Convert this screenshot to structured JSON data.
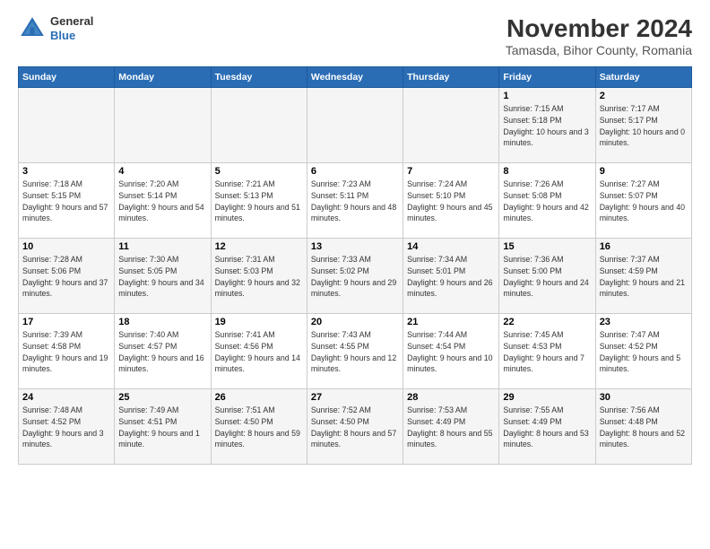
{
  "header": {
    "logo_line1": "General",
    "logo_line2": "Blue",
    "title": "November 2024",
    "subtitle": "Tamasda, Bihor County, Romania"
  },
  "weekdays": [
    "Sunday",
    "Monday",
    "Tuesday",
    "Wednesday",
    "Thursday",
    "Friday",
    "Saturday"
  ],
  "weeks": [
    [
      {
        "day": "",
        "sunrise": "",
        "sunset": "",
        "daylight": ""
      },
      {
        "day": "",
        "sunrise": "",
        "sunset": "",
        "daylight": ""
      },
      {
        "day": "",
        "sunrise": "",
        "sunset": "",
        "daylight": ""
      },
      {
        "day": "",
        "sunrise": "",
        "sunset": "",
        "daylight": ""
      },
      {
        "day": "",
        "sunrise": "",
        "sunset": "",
        "daylight": ""
      },
      {
        "day": "1",
        "sunrise": "Sunrise: 7:15 AM",
        "sunset": "Sunset: 5:18 PM",
        "daylight": "Daylight: 10 hours and 3 minutes."
      },
      {
        "day": "2",
        "sunrise": "Sunrise: 7:17 AM",
        "sunset": "Sunset: 5:17 PM",
        "daylight": "Daylight: 10 hours and 0 minutes."
      }
    ],
    [
      {
        "day": "3",
        "sunrise": "Sunrise: 7:18 AM",
        "sunset": "Sunset: 5:15 PM",
        "daylight": "Daylight: 9 hours and 57 minutes."
      },
      {
        "day": "4",
        "sunrise": "Sunrise: 7:20 AM",
        "sunset": "Sunset: 5:14 PM",
        "daylight": "Daylight: 9 hours and 54 minutes."
      },
      {
        "day": "5",
        "sunrise": "Sunrise: 7:21 AM",
        "sunset": "Sunset: 5:13 PM",
        "daylight": "Daylight: 9 hours and 51 minutes."
      },
      {
        "day": "6",
        "sunrise": "Sunrise: 7:23 AM",
        "sunset": "Sunset: 5:11 PM",
        "daylight": "Daylight: 9 hours and 48 minutes."
      },
      {
        "day": "7",
        "sunrise": "Sunrise: 7:24 AM",
        "sunset": "Sunset: 5:10 PM",
        "daylight": "Daylight: 9 hours and 45 minutes."
      },
      {
        "day": "8",
        "sunrise": "Sunrise: 7:26 AM",
        "sunset": "Sunset: 5:08 PM",
        "daylight": "Daylight: 9 hours and 42 minutes."
      },
      {
        "day": "9",
        "sunrise": "Sunrise: 7:27 AM",
        "sunset": "Sunset: 5:07 PM",
        "daylight": "Daylight: 9 hours and 40 minutes."
      }
    ],
    [
      {
        "day": "10",
        "sunrise": "Sunrise: 7:28 AM",
        "sunset": "Sunset: 5:06 PM",
        "daylight": "Daylight: 9 hours and 37 minutes."
      },
      {
        "day": "11",
        "sunrise": "Sunrise: 7:30 AM",
        "sunset": "Sunset: 5:05 PM",
        "daylight": "Daylight: 9 hours and 34 minutes."
      },
      {
        "day": "12",
        "sunrise": "Sunrise: 7:31 AM",
        "sunset": "Sunset: 5:03 PM",
        "daylight": "Daylight: 9 hours and 32 minutes."
      },
      {
        "day": "13",
        "sunrise": "Sunrise: 7:33 AM",
        "sunset": "Sunset: 5:02 PM",
        "daylight": "Daylight: 9 hours and 29 minutes."
      },
      {
        "day": "14",
        "sunrise": "Sunrise: 7:34 AM",
        "sunset": "Sunset: 5:01 PM",
        "daylight": "Daylight: 9 hours and 26 minutes."
      },
      {
        "day": "15",
        "sunrise": "Sunrise: 7:36 AM",
        "sunset": "Sunset: 5:00 PM",
        "daylight": "Daylight: 9 hours and 24 minutes."
      },
      {
        "day": "16",
        "sunrise": "Sunrise: 7:37 AM",
        "sunset": "Sunset: 4:59 PM",
        "daylight": "Daylight: 9 hours and 21 minutes."
      }
    ],
    [
      {
        "day": "17",
        "sunrise": "Sunrise: 7:39 AM",
        "sunset": "Sunset: 4:58 PM",
        "daylight": "Daylight: 9 hours and 19 minutes."
      },
      {
        "day": "18",
        "sunrise": "Sunrise: 7:40 AM",
        "sunset": "Sunset: 4:57 PM",
        "daylight": "Daylight: 9 hours and 16 minutes."
      },
      {
        "day": "19",
        "sunrise": "Sunrise: 7:41 AM",
        "sunset": "Sunset: 4:56 PM",
        "daylight": "Daylight: 9 hours and 14 minutes."
      },
      {
        "day": "20",
        "sunrise": "Sunrise: 7:43 AM",
        "sunset": "Sunset: 4:55 PM",
        "daylight": "Daylight: 9 hours and 12 minutes."
      },
      {
        "day": "21",
        "sunrise": "Sunrise: 7:44 AM",
        "sunset": "Sunset: 4:54 PM",
        "daylight": "Daylight: 9 hours and 10 minutes."
      },
      {
        "day": "22",
        "sunrise": "Sunrise: 7:45 AM",
        "sunset": "Sunset: 4:53 PM",
        "daylight": "Daylight: 9 hours and 7 minutes."
      },
      {
        "day": "23",
        "sunrise": "Sunrise: 7:47 AM",
        "sunset": "Sunset: 4:52 PM",
        "daylight": "Daylight: 9 hours and 5 minutes."
      }
    ],
    [
      {
        "day": "24",
        "sunrise": "Sunrise: 7:48 AM",
        "sunset": "Sunset: 4:52 PM",
        "daylight": "Daylight: 9 hours and 3 minutes."
      },
      {
        "day": "25",
        "sunrise": "Sunrise: 7:49 AM",
        "sunset": "Sunset: 4:51 PM",
        "daylight": "Daylight: 9 hours and 1 minute."
      },
      {
        "day": "26",
        "sunrise": "Sunrise: 7:51 AM",
        "sunset": "Sunset: 4:50 PM",
        "daylight": "Daylight: 8 hours and 59 minutes."
      },
      {
        "day": "27",
        "sunrise": "Sunrise: 7:52 AM",
        "sunset": "Sunset: 4:50 PM",
        "daylight": "Daylight: 8 hours and 57 minutes."
      },
      {
        "day": "28",
        "sunrise": "Sunrise: 7:53 AM",
        "sunset": "Sunset: 4:49 PM",
        "daylight": "Daylight: 8 hours and 55 minutes."
      },
      {
        "day": "29",
        "sunrise": "Sunrise: 7:55 AM",
        "sunset": "Sunset: 4:49 PM",
        "daylight": "Daylight: 8 hours and 53 minutes."
      },
      {
        "day": "30",
        "sunrise": "Sunrise: 7:56 AM",
        "sunset": "Sunset: 4:48 PM",
        "daylight": "Daylight: 8 hours and 52 minutes."
      }
    ]
  ]
}
